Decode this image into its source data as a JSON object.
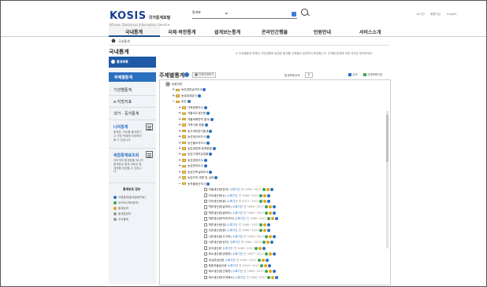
{
  "header": {
    "logo": "KOSIS",
    "logo_kr": "국가통계포털",
    "logo_sub": "KOrean Statistical Information Service",
    "search_select": "통계표",
    "util": [
      "로그인",
      "회원가입",
      "English"
    ]
  },
  "gnb": [
    "국내통계",
    "국제·북한통계",
    "쉽게보는통계",
    "온라인간행물",
    "민원안내",
    "서비스소개"
  ],
  "breadcrumb": "국내통계",
  "sidebar": {
    "title": "국내통계",
    "head": "통계목록",
    "items": [
      "주제별통계",
      "기관별통계",
      "e-지방지표",
      "과거 · 중지통계"
    ],
    "my_title": "나의통계",
    "my_text": "통계표, 차트를 즐겨찾기 고 선정 목록에 저장하여 볼 수 있습니다.",
    "combine_title": "복합통계표조회",
    "combine_text": "여러개의 통계표를 하나의 통계표로 합쳐 새로운 통계표를 생성할 수 있습니다.",
    "info_title": "통계부호 정보",
    "info": [
      "이용통계(통계설명자료)",
      "KOSIS(여러정보)",
      "통계검색",
      "통계표정보",
      "주요통계"
    ]
  },
  "main": {
    "notice": "※ 주제별통계 목록은 국민생활에 밀접한 통계를 주제별로 분류하여 제공합니다. 주제별 통계에 대한 의견은 문의하세요.",
    "title": "주제별통계",
    "btn_all": "전체주제보기",
    "meta_label": "통계목록검색",
    "meta_value": "0",
    "btn_search": "검색",
    "btn_excel": "전체목록다운"
  },
  "tree": [
    {
      "text": "농림어업",
      "indent": 0,
      "type": "root"
    },
    {
      "text": "농업경영실적조사",
      "indent": 1,
      "type": "folder",
      "exp": "+"
    },
    {
      "text": "농업회계분석",
      "indent": 1,
      "type": "folder",
      "exp": "+"
    },
    {
      "text": "농업",
      "indent": 1,
      "type": "folder",
      "exp": "−"
    },
    {
      "text": "가축동향조사",
      "indent": 2,
      "type": "folder",
      "exp": "+"
    },
    {
      "text": "곡물과수생산량",
      "indent": 2,
      "type": "folder",
      "exp": "+"
    },
    {
      "text": "작물재배면적 통계",
      "indent": 2,
      "type": "folder",
      "exp": "+"
    },
    {
      "text": "가축사육 현황",
      "indent": 2,
      "type": "folder",
      "exp": "+"
    },
    {
      "text": "농가계부분석통계",
      "indent": 2,
      "type": "folder",
      "exp": "+"
    },
    {
      "text": "농업생산비조사",
      "indent": 2,
      "type": "folder",
      "exp": "+"
    },
    {
      "text": "농산물소득조사",
      "indent": 2,
      "type": "folder",
      "exp": "+"
    },
    {
      "text": "농업경영체 등록현황",
      "indent": 2,
      "type": "folder",
      "exp": "+"
    },
    {
      "text": "농업기계보유현황",
      "indent": 2,
      "type": "folder",
      "exp": "+"
    },
    {
      "text": "농업경영조사",
      "indent": 2,
      "type": "folder",
      "exp": "+"
    },
    {
      "text": "농업면적조사",
      "indent": 2,
      "type": "folder",
      "exp": "+"
    },
    {
      "text": "농업인력실태조사",
      "indent": 2,
      "type": "folder",
      "exp": "+"
    },
    {
      "text": "농업인의 영향 및 실태",
      "indent": 2,
      "type": "folder",
      "exp": "+"
    },
    {
      "text": "농작물생산조사",
      "indent": 2,
      "type": "folder",
      "exp": "−"
    },
    {
      "text": "곡물생산량(정곡)",
      "indent": 3,
      "type": "doc",
      "link": "수록기간",
      "period": "연 1998~2017"
    },
    {
      "text": "미곡생산량(논)",
      "indent": 3,
      "type": "doc",
      "link": "수록기간",
      "period": "연 1980~2017"
    },
    {
      "text": "미곡생산량(밭)",
      "indent": 3,
      "type": "doc",
      "link": "수록기간",
      "period": "연 2011~2017"
    },
    {
      "text": "맥류생산량(겉보리)",
      "indent": 3,
      "type": "doc",
      "link": "수록기간",
      "period": "연 1980~2017"
    },
    {
      "text": "맥류생산량(쌀보리)",
      "indent": 3,
      "type": "doc",
      "link": "수록기간",
      "period": "연 1980~2017"
    },
    {
      "text": "맥류생산량(맥주보리)",
      "indent": 3,
      "type": "doc",
      "link": "수록기간",
      "period": "연 1980~2017"
    },
    {
      "text": "맥류생산량(밀)",
      "indent": 3,
      "type": "doc",
      "link": "수록기간",
      "period": "연 1980~2017"
    },
    {
      "text": "두류생산량(콩)",
      "indent": 3,
      "type": "doc",
      "link": "수록기간",
      "period": "연 1980~2017"
    },
    {
      "text": "서류생산량(고구마)",
      "indent": 3,
      "type": "doc",
      "link": "수록기간",
      "period": "연 1980~2017"
    },
    {
      "text": "서류생산량(감자)",
      "indent": 3,
      "type": "doc",
      "link": "수록기간",
      "period": "연 1980~2017"
    },
    {
      "text": "잡곡생산량",
      "indent": 3,
      "type": "doc",
      "link": "수록기간",
      "period": "연 1980~2017"
    },
    {
      "text": "채소생산량(엽채류)",
      "indent": 3,
      "type": "doc",
      "link": "수록기간",
      "period": "연 1997~2017"
    },
    {
      "text": "과실류생산량",
      "indent": 3,
      "type": "doc",
      "link": "수록기간",
      "period": "연 2000~2017"
    },
    {
      "text": "특용작물생산량",
      "indent": 3,
      "type": "doc",
      "link": "수록기간",
      "period": "연 2000~2017"
    },
    {
      "text": "채소생산량(근채류)",
      "indent": 3,
      "type": "doc",
      "link": "수록기간",
      "period": "연 1980~2017"
    },
    {
      "text": "채소생산량(조미채소)",
      "indent": 3,
      "type": "doc",
      "link": "수록기간",
      "period": "연 1980~2017"
    }
  ]
}
